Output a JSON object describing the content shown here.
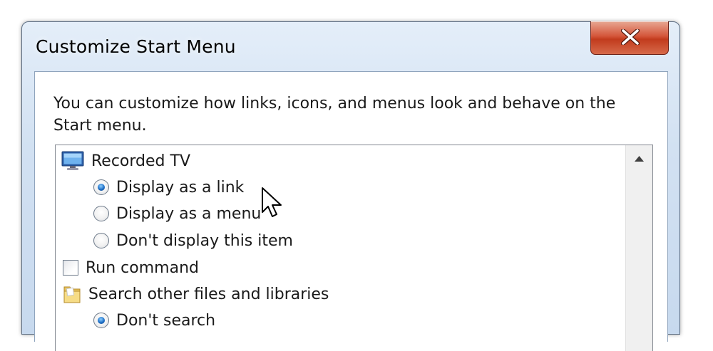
{
  "window": {
    "title": "Customize Start Menu"
  },
  "description": "You can customize how links, icons, and menus look and behave on the Start menu.",
  "options": [
    {
      "kind": "header",
      "icon": "tv-icon",
      "label": "Recorded TV"
    },
    {
      "kind": "radio",
      "label": "Display as a link",
      "checked": true
    },
    {
      "kind": "radio",
      "label": "Display as a menu",
      "checked": false
    },
    {
      "kind": "radio",
      "label": "Don't display this item",
      "checked": false
    },
    {
      "kind": "checkbox",
      "label": "Run command",
      "checked": false
    },
    {
      "kind": "header",
      "icon": "folder-icon",
      "label": "Search other files and libraries"
    },
    {
      "kind": "radio",
      "label": "Don't search",
      "checked": true
    }
  ],
  "icons": {
    "close": "close-icon",
    "scroll_up": "scroll-up-arrow-icon",
    "cursor": "mouse-cursor-icon"
  },
  "colors": {
    "close_button": "#c8452a",
    "radio_selected": "#1e6fc7",
    "window_frame": "#c7d9ee"
  }
}
